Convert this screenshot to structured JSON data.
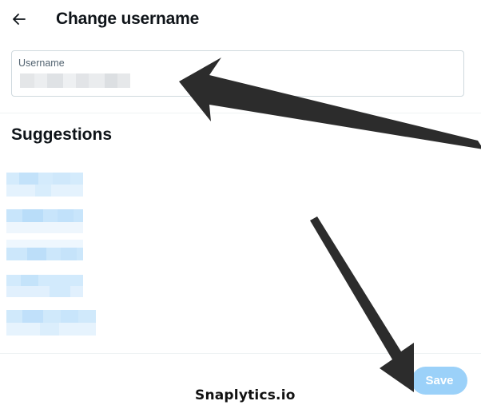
{
  "header": {
    "title": "Change username",
    "back_icon": "arrow-left-icon"
  },
  "username_field": {
    "label": "Username",
    "value_redacted": true
  },
  "suggestions": {
    "title": "Suggestions",
    "items_redacted": 5
  },
  "footer": {
    "save_label": "Save"
  },
  "watermark": "Snaplytics.io",
  "colors": {
    "save_button_bg": "#9bd1f9",
    "arrow": "#2c2c2c",
    "suggestion_pixel": "#c9e6fb"
  }
}
